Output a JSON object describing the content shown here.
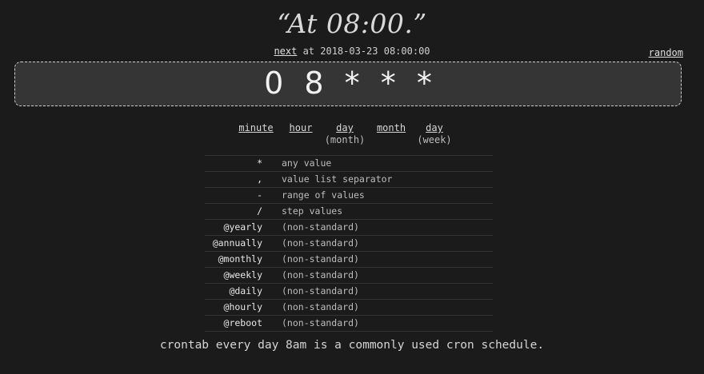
{
  "headline": "“At 08:00.”",
  "next": {
    "link": "next",
    "text": " at 2018-03-23 08:00:00"
  },
  "random_label": "random",
  "cron_expression": "0 8 * * *",
  "fields": [
    {
      "main": "minute",
      "sub": ""
    },
    {
      "main": "hour",
      "sub": ""
    },
    {
      "main": "day",
      "sub": "(month)"
    },
    {
      "main": "month",
      "sub": ""
    },
    {
      "main": "day",
      "sub": "(week)"
    }
  ],
  "legend": [
    {
      "symbol": "*",
      "description": "any value"
    },
    {
      "symbol": ",",
      "description": "value list separator"
    },
    {
      "symbol": "-",
      "description": "range of values"
    },
    {
      "symbol": "/",
      "description": "step values"
    },
    {
      "symbol": "@yearly",
      "description": "(non-standard)"
    },
    {
      "symbol": "@annually",
      "description": "(non-standard)"
    },
    {
      "symbol": "@monthly",
      "description": "(non-standard)"
    },
    {
      "symbol": "@weekly",
      "description": "(non-standard)"
    },
    {
      "symbol": "@daily",
      "description": "(non-standard)"
    },
    {
      "symbol": "@hourly",
      "description": "(non-standard)"
    },
    {
      "symbol": "@reboot",
      "description": "(non-standard)"
    }
  ],
  "footer": "crontab every day 8am is a commonly used cron schedule."
}
